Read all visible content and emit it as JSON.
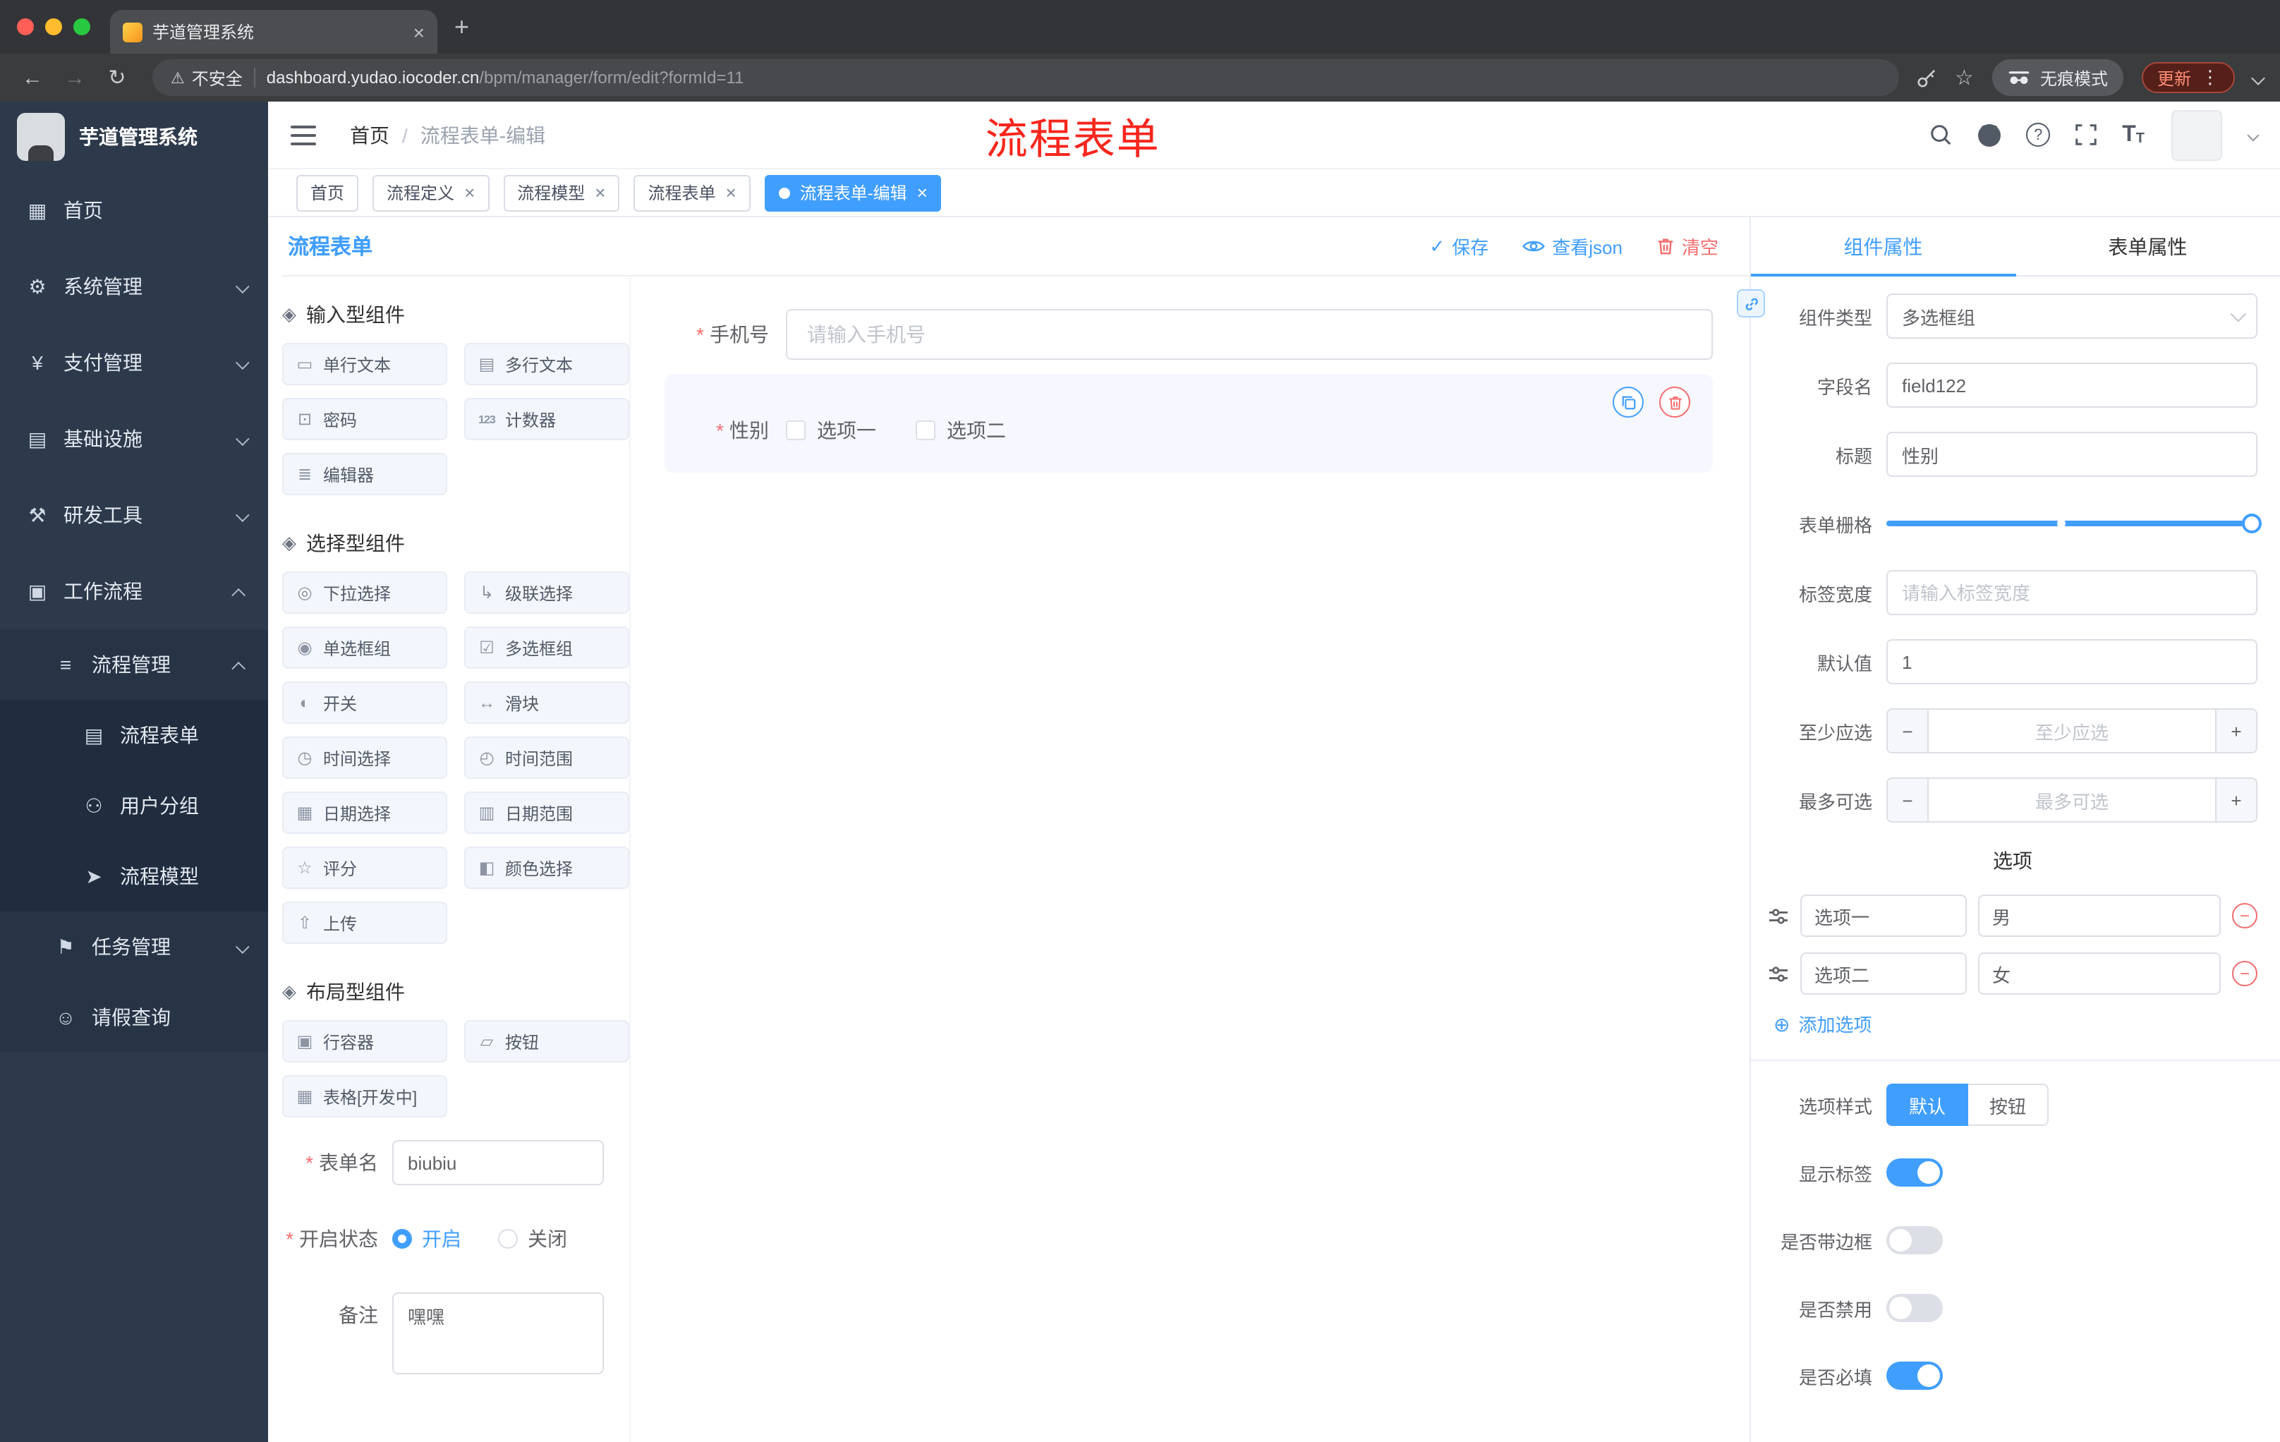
{
  "colors": {
    "accent": "#409eff",
    "danger": "#f56c6c",
    "sidebar_bg": "#2d3a4b",
    "tag_active": "#409eff"
  },
  "icons": {
    "close": "×",
    "plus": "+",
    "minus": "−",
    "back": "←",
    "forward": "→",
    "reload": "↻",
    "warning": "⚠",
    "star": "☆",
    "menu_dots": "⋮",
    "question": "?",
    "font_size_big": "T",
    "font_size_small": "T",
    "check": "✓",
    "circle_plus": "⊕",
    "group": "◈",
    "breadcrumb_sep": "/"
  },
  "browser": {
    "tab_title": "芋道管理系统",
    "security_label": "不安全",
    "url_domain": "dashboard.yudao.iocoder.cn",
    "url_path": "/bpm/manager/form/edit?formId=11",
    "incognito_label": "无痕模式",
    "update_label": "更新"
  },
  "sidebar": {
    "logo_title": "芋道管理系统",
    "menu": [
      {
        "label": "首页",
        "icon": "▦"
      },
      {
        "label": "系统管理",
        "icon": "⚙"
      },
      {
        "label": "支付管理",
        "icon": "¥"
      },
      {
        "label": "基础设施",
        "icon": "▤"
      },
      {
        "label": "研发工具",
        "icon": "⚒"
      },
      {
        "label": "工作流程",
        "icon": "▣"
      },
      {
        "label": "流程管理",
        "icon": "≡"
      },
      {
        "label": "流程表单",
        "icon": "▤"
      },
      {
        "label": "用户分组",
        "icon": "⚇"
      },
      {
        "label": "流程模型",
        "icon": "➤"
      },
      {
        "label": "任务管理",
        "icon": "⚑"
      },
      {
        "label": "请假查询",
        "icon": "☺"
      }
    ]
  },
  "header": {
    "breadcrumb_home": "首页",
    "breadcrumb_current": "流程表单-编辑",
    "annotation": "流程表单"
  },
  "tags": [
    {
      "label": "首页"
    },
    {
      "label": "流程定义"
    },
    {
      "label": "流程模型"
    },
    {
      "label": "流程表单"
    },
    {
      "label": "流程表单-编辑"
    }
  ],
  "designer": {
    "title": "流程表单",
    "actions": {
      "save": "保存",
      "view_json": "查看json",
      "clear": "清空"
    },
    "palette": {
      "group0": {
        "title": "输入型组件",
        "items": [
          {
            "label": "单行文本",
            "icon": "▭"
          },
          {
            "label": "多行文本",
            "icon": "▤"
          },
          {
            "label": "密码",
            "icon": "⊡"
          },
          {
            "label": "计数器",
            "icon": "123"
          },
          {
            "label": "编辑器",
            "icon": "≣"
          }
        ]
      },
      "group1": {
        "title": "选择型组件",
        "items": [
          {
            "label": "下拉选择",
            "icon": "◎"
          },
          {
            "label": "级联选择",
            "icon": "↳"
          },
          {
            "label": "单选框组",
            "icon": "◉"
          },
          {
            "label": "多选框组",
            "icon": "☑"
          },
          {
            "label": "开关",
            "icon": "◐"
          },
          {
            "label": "滑块",
            "icon": "↔"
          },
          {
            "label": "时间选择",
            "icon": "◷"
          },
          {
            "label": "时间范围",
            "icon": "◴"
          },
          {
            "label": "日期选择",
            "icon": "▦"
          },
          {
            "label": "日期范围",
            "icon": "▥"
          },
          {
            "label": "评分",
            "icon": "☆"
          },
          {
            "label": "颜色选择",
            "icon": "◧"
          },
          {
            "label": "上传",
            "icon": "⇧"
          }
        ]
      },
      "group2": {
        "title": "布局型组件",
        "items": [
          {
            "label": "行容器",
            "icon": "▣"
          },
          {
            "label": "按钮",
            "icon": "▱"
          },
          {
            "label": "表格[开发中]",
            "icon": "▦"
          }
        ]
      }
    },
    "meta": {
      "name_label": "表单名",
      "name_value": "biubiu",
      "status_label": "开启状态",
      "status_on": "开启",
      "status_off": "关闭",
      "remark_label": "备注",
      "remark_value": "嘿嘿"
    },
    "canvas": {
      "phone_label": "手机号",
      "phone_placeholder": "请输入手机号",
      "gender_label": "性别",
      "gender_opt1": "选项一",
      "gender_opt2": "选项二"
    },
    "props": {
      "tab_component": "组件属性",
      "tab_form": "表单属性",
      "type_label": "组件类型",
      "type_value": "多选框组",
      "field_label": "字段名",
      "field_value": "field122",
      "title_label": "标题",
      "title_value": "性别",
      "grid_label": "表单栅格",
      "labelwidth_label": "标签宽度",
      "labelwidth_placeholder": "请输入标签宽度",
      "default_label": "默认值",
      "default_value": "1",
      "min_label": "至少应选",
      "min_placeholder": "至少应选",
      "max_label": "最多可选",
      "max_placeholder": "最多可选",
      "options_title": "选项",
      "options": [
        {
          "name": "选项一",
          "value": "男"
        },
        {
          "name": "选项二",
          "value": "女"
        }
      ],
      "add_option": "添加选项",
      "style_label": "选项样式",
      "style_default": "默认",
      "style_button": "按钮",
      "toggle_show_label": "显示标签",
      "toggle_border_label": "是否带边框",
      "toggle_disabled_label": "是否禁用",
      "toggle_required_label": "是否必填"
    }
  }
}
